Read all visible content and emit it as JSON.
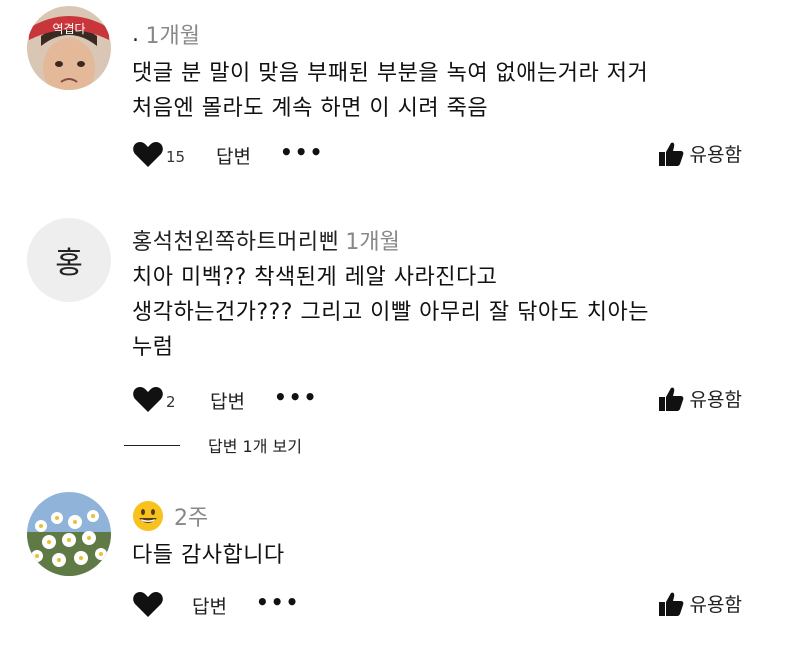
{
  "comments": [
    {
      "avatar_label": "역겹다",
      "author": ".",
      "time": "1개월",
      "text": "댓글 분 말이 맞음 부패된 부분을 녹여 없애는거라 저거\n처음엔 몰라도 계속 하면 이 시려 죽음",
      "likes": "15",
      "reply_label": "답변",
      "more_label": "•••",
      "useful_label": "유용함"
    },
    {
      "avatar_label": "홍",
      "author": "홍석천왼쪽하트머리삔",
      "time": "1개월",
      "text": "치아 미백?? 착색된게 레알 사라진다고\n생각하는건가??? 그리고 이빨 아무리 잘 닦아도 치아는\n누럼",
      "likes": "2",
      "reply_label": "답변",
      "more_label": "•••",
      "useful_label": "유용함",
      "view_replies": "답변 1개 보기"
    },
    {
      "author_icon": "grinning-face-emoji",
      "time": "2주",
      "text": "다들 감사합니다",
      "likes": "",
      "reply_label": "답변",
      "more_label": "•••",
      "useful_label": "유용함"
    }
  ],
  "colors": {
    "text": "#111111",
    "muted": "#888888",
    "avatar_bg": "#eeeeee",
    "badge_red": "#c8353b"
  },
  "icons": [
    "heart-icon",
    "thumbs-up-icon",
    "more-icon"
  ]
}
